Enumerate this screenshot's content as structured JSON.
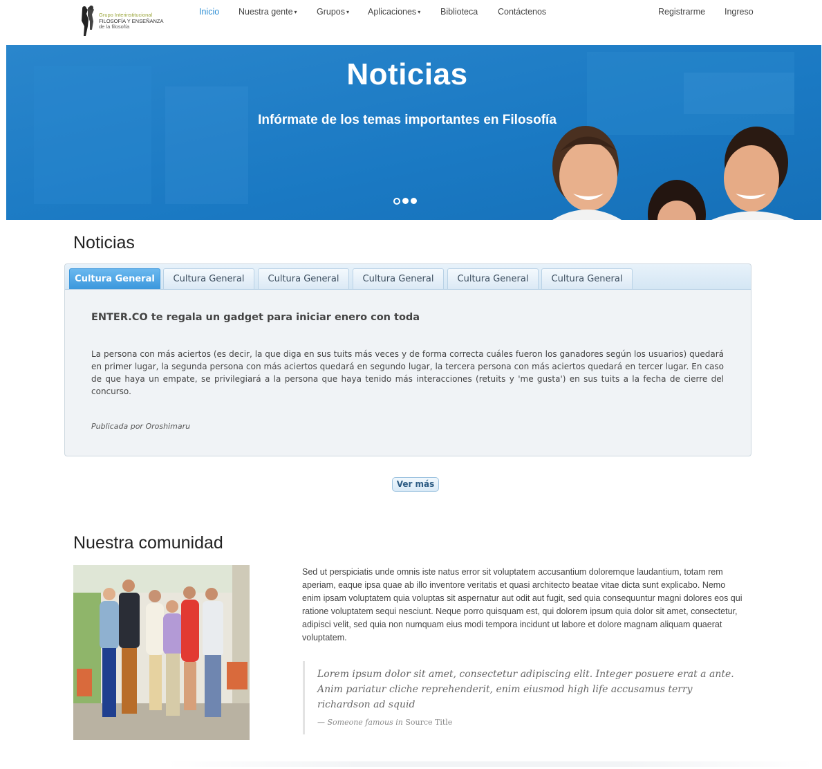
{
  "logo": {
    "line1": "Grupo Interinstitucional",
    "line2": "FILOSOFÍA Y ENSEÑANZA",
    "line3": "de la filosofía"
  },
  "nav": {
    "items": [
      {
        "label": "Inicio",
        "active": true
      },
      {
        "label": "Nuestra gente",
        "dropdown": true
      },
      {
        "label": "Grupos",
        "dropdown": true
      },
      {
        "label": "Aplicaciones",
        "dropdown": true
      },
      {
        "label": "Biblioteca"
      },
      {
        "label": "Contáctenos"
      }
    ],
    "register": "Registrarme",
    "login": "Ingreso",
    "caret": "▾"
  },
  "hero": {
    "title": "Noticias",
    "subtitle": "Infórmate de los temas importantes en Filosofía",
    "active_slide": 2,
    "slide_count": 3
  },
  "news": {
    "section_title": "Noticias",
    "tabs": [
      "Cultura General",
      "Cultura General",
      "Cultura General",
      "Cultura General",
      "Cultura General",
      "Cultura General"
    ],
    "active_tab": 0,
    "headline": "ENTER.CO te regala un gadget para iniciar enero con toda",
    "body": "La persona con más aciertos (es decir, la que diga en sus tuits más veces y de forma correcta cuáles fueron los ganadores según los usuarios) quedará en primer lugar, la segunda persona con más aciertos quedará en segundo lugar, la tercera persona con más aciertos quedará en tercer lugar. En caso de que haya un empate, se privilegiará a la persona que haya tenido más interacciones (retuits y 'me gusta') en sus tuits a la fecha de cierre del concurso.",
    "author": "Publicada por Oroshimaru",
    "more_button": "Ver más"
  },
  "community": {
    "section_title": "Nuestra comunidad",
    "text": "Sed ut perspiciatis unde omnis iste natus error sit voluptatem accusantium doloremque laudantium, totam rem aperiam, eaque ipsa quae ab illo inventore veritatis et quasi architecto beatae vitae dicta sunt explicabo. Nemo enim ipsam voluptatem quia voluptas sit aspernatur aut odit aut fugit, sed quia consequuntur magni dolores eos qui ratione voluptatem sequi nesciunt. Neque porro quisquam est, qui dolorem ipsum quia dolor sit amet, consectetur, adipisci velit, sed quia non numquam eius modi tempora incidunt ut labore et dolore magnam aliquam quaerat voluptatem.",
    "quote": "Lorem ipsum dolor sit amet, consectetur adipiscing elit. Integer posuere erat a ante. Anim pariatur cliche reprehenderit, enim eiusmod high life accusamus terry richardson ad squid",
    "cite_prefix": "— Someone famous in",
    "cite_source": "Source Title"
  },
  "colors": {
    "brand_blue": "#1c7cc6",
    "nav_active": "#2d8ed4",
    "tab_active": "#3b97dc"
  }
}
